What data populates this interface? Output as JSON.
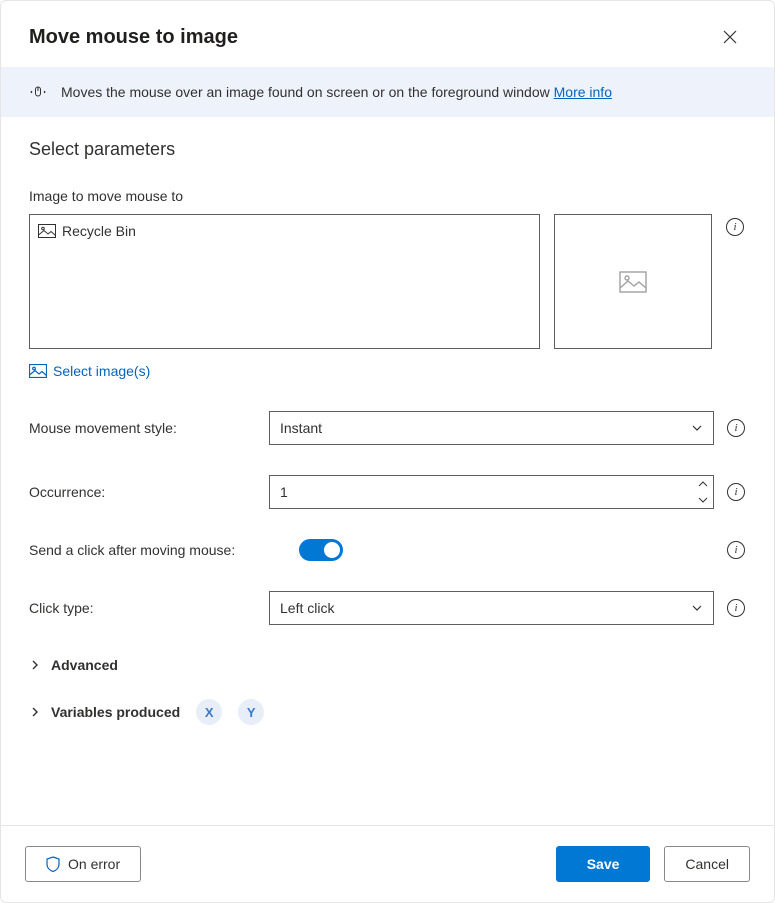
{
  "header": {
    "title": "Move mouse to image"
  },
  "banner": {
    "text": "Moves the mouse over an image found on screen or on the foreground window ",
    "link": "More info"
  },
  "section": {
    "title": "Select parameters"
  },
  "imageField": {
    "label": "Image to move mouse to",
    "item": "Recycle Bin",
    "selectLabel": "Select image(s)"
  },
  "params": {
    "movementStyle": {
      "label": "Mouse movement style:",
      "value": "Instant"
    },
    "occurrence": {
      "label": "Occurrence:",
      "value": "1"
    },
    "sendClick": {
      "label": "Send a click after moving mouse:"
    },
    "clickType": {
      "label": "Click type:",
      "value": "Left click"
    }
  },
  "advanced": {
    "label": "Advanced"
  },
  "variables": {
    "label": "Variables produced",
    "var1": "X",
    "var2": "Y"
  },
  "footer": {
    "onError": "On error",
    "save": "Save",
    "cancel": "Cancel"
  }
}
